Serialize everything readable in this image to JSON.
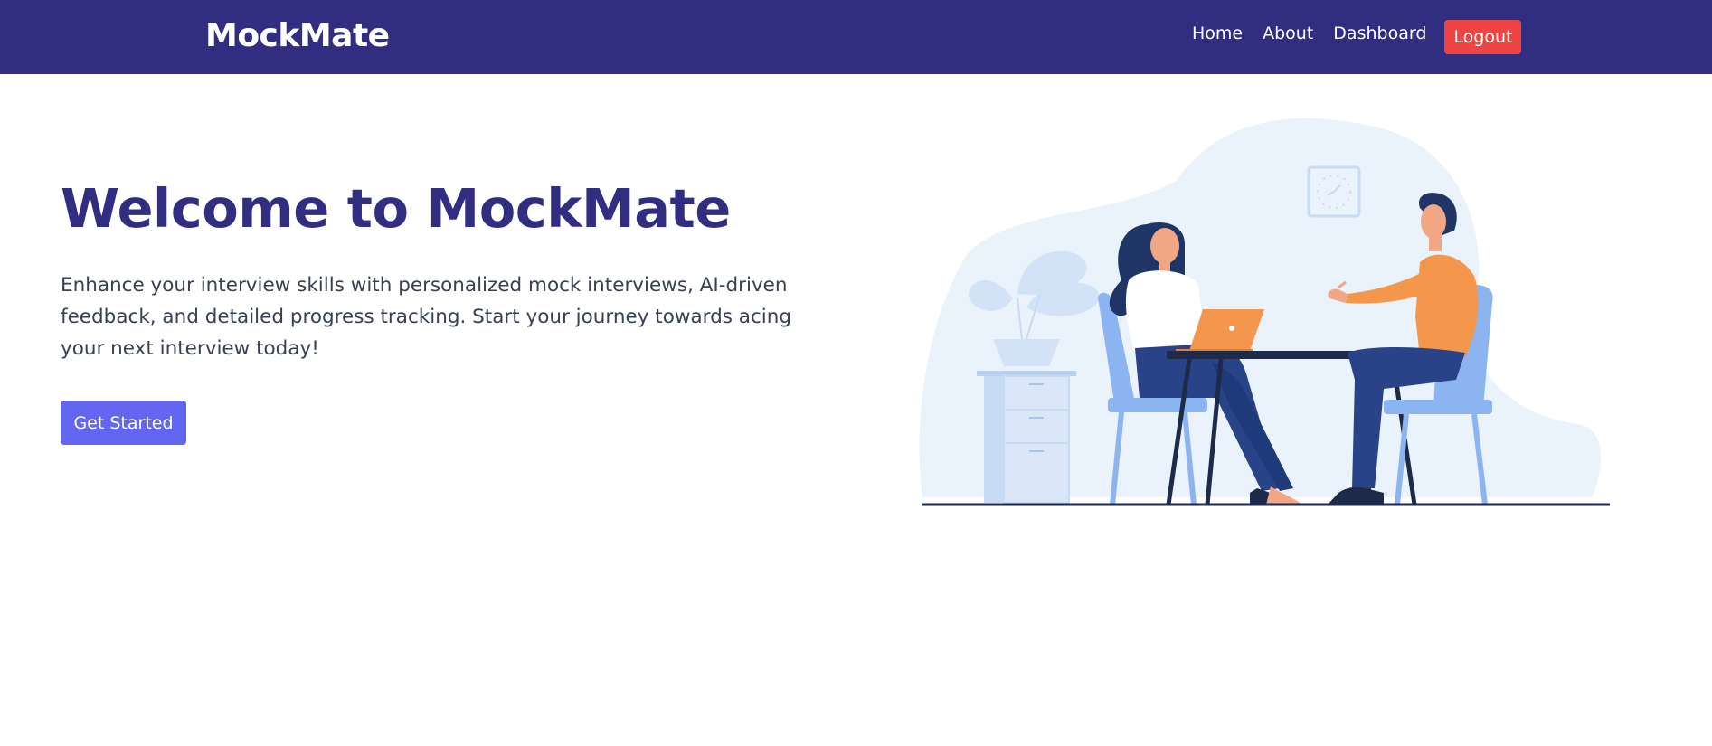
{
  "nav": {
    "brand": "MockMate",
    "links": [
      "Home",
      "About",
      "Dashboard"
    ],
    "logout_label": "Logout"
  },
  "hero": {
    "title": "Welcome to MockMate",
    "description": "Enhance your interview skills with personalized mock interviews, AI-driven feedback, and detailed progress tracking. Start your journey towards acing your next interview today!",
    "cta_label": "Get Started"
  },
  "illustration": {
    "name": "interview-illustration",
    "colors": {
      "blob": "#eaf2fb",
      "chair": "#8cb4f0",
      "desk": "#1e2a4a",
      "laptop": "#f4964b",
      "man_shirt": "#f4964b",
      "pants": "#294389",
      "hair": "#1e3566",
      "plant": "#d3e3f7"
    }
  },
  "colors": {
    "navbar": "#312e81",
    "title": "#312e81",
    "logout": "#ef4444",
    "cta": "#6366f1",
    "body_text": "#374151"
  }
}
